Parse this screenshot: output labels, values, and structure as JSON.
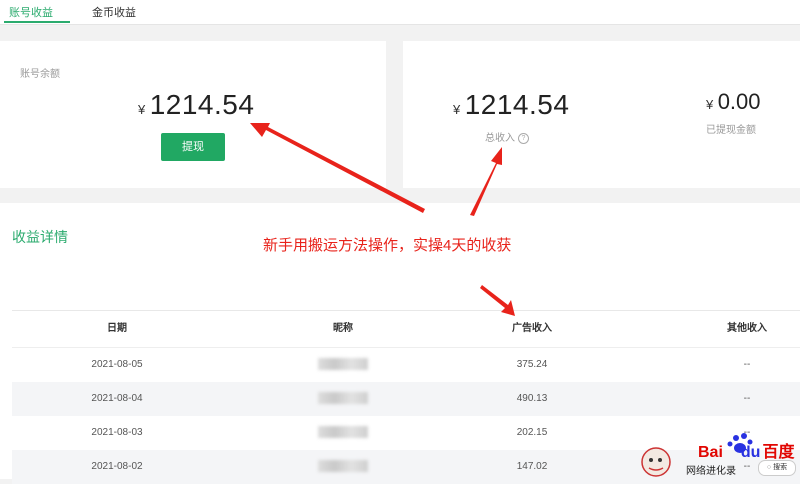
{
  "tabs": [
    {
      "label": "账号收益",
      "active": true
    },
    {
      "label": "金币收益",
      "active": false
    }
  ],
  "balance_card": {
    "label": "账号余额",
    "currency": "¥",
    "amount": "1214.54",
    "withdraw_button": "提现"
  },
  "income_card": {
    "total": {
      "currency": "¥",
      "amount": "1214.54",
      "label": "总收入",
      "help_icon": "?"
    },
    "withdrawn": {
      "currency": "¥",
      "amount": "0.00",
      "label": "已提现金额"
    }
  },
  "details": {
    "title": "收益详情",
    "columns": [
      "日期",
      "昵称",
      "广告收入",
      "其他收入"
    ],
    "rows": [
      {
        "date": "2021-08-05",
        "ad_income": "375.24",
        "other": "--"
      },
      {
        "date": "2021-08-04",
        "ad_income": "490.13",
        "other": "--"
      },
      {
        "date": "2021-08-03",
        "ad_income": "202.15",
        "other": "--"
      },
      {
        "date": "2021-08-02",
        "ad_income": "147.02",
        "other": "--"
      }
    ]
  },
  "annotation": {
    "text": "新手用搬运方法操作，实操4天的收获",
    "color": "#e8231b"
  },
  "watermark": {
    "brand_bai": "Bai",
    "brand_du": "du",
    "brand_cn": "百度",
    "site": "网络进化录",
    "search": "搜索"
  },
  "colors": {
    "accent": "#2bab6e",
    "button": "#21a863",
    "annotation": "#e8231b"
  }
}
